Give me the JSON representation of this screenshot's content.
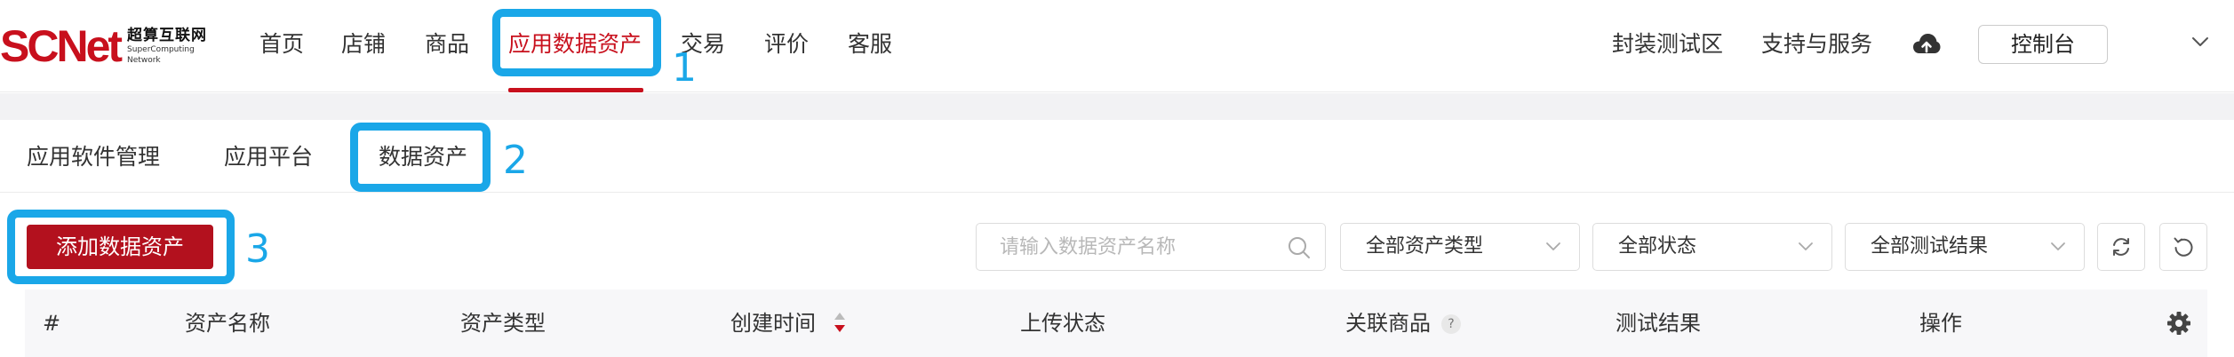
{
  "brand": {
    "logo_mark": "SCNet",
    "name_cn": "超算互联网",
    "name_en_line1": "SuperComputing",
    "name_en_line2": "Network"
  },
  "nav": {
    "items": [
      {
        "label": "首页"
      },
      {
        "label": "店铺"
      },
      {
        "label": "商品"
      },
      {
        "label": "应用数据资产",
        "active": true
      },
      {
        "label": "交易"
      },
      {
        "label": "评价"
      },
      {
        "label": "客服"
      }
    ],
    "right_items": [
      {
        "label": "封装测试区"
      },
      {
        "label": "支持与服务"
      }
    ],
    "cloud_icon": "cloud-upload-icon",
    "console_label": "控制台"
  },
  "subtabs": {
    "items": [
      {
        "label": "应用软件管理"
      },
      {
        "label": "应用平台"
      },
      {
        "label": "数据资产",
        "active": true
      }
    ]
  },
  "toolbar": {
    "add_label": "添加数据资产",
    "search_placeholder": "请输入数据资产名称",
    "filters": [
      {
        "label": "全部资产类型"
      },
      {
        "label": "全部状态"
      },
      {
        "label": "全部测试结果"
      }
    ]
  },
  "table": {
    "columns": [
      {
        "label": "#"
      },
      {
        "label": "资产名称"
      },
      {
        "label": "资产类型"
      },
      {
        "label": "创建时间"
      },
      {
        "label": "上传状态"
      },
      {
        "label": "关联商品"
      },
      {
        "label": "测试结果"
      },
      {
        "label": "操作"
      }
    ],
    "help_mark": "?"
  },
  "annotations": [
    {
      "number": "1"
    },
    {
      "number": "2"
    },
    {
      "number": "3"
    }
  ],
  "colors": {
    "brand_red": "#c8101d",
    "button_red": "#b3111e",
    "annotation_blue": "#1aa7e8"
  }
}
